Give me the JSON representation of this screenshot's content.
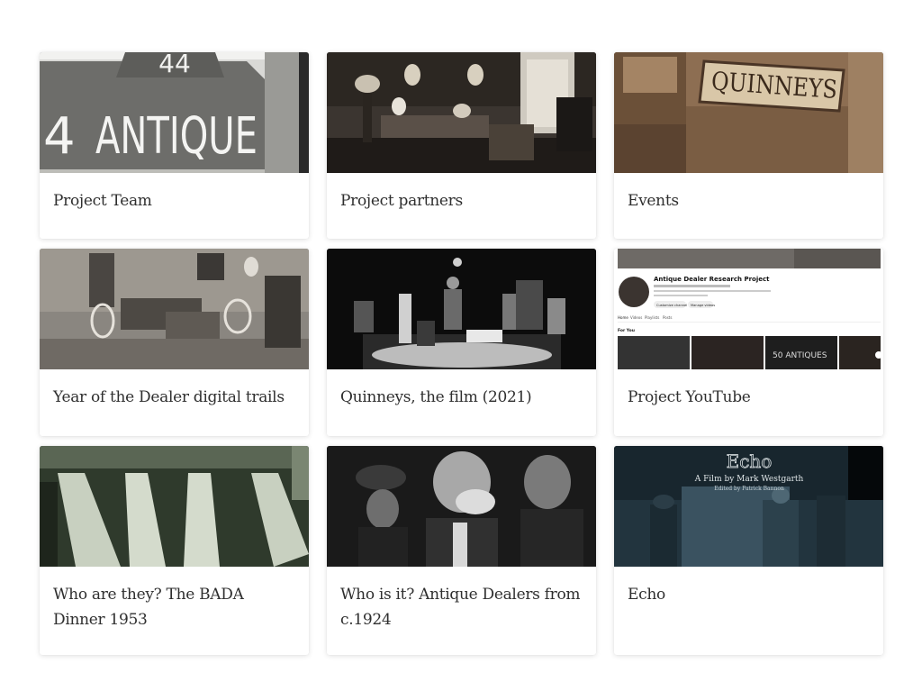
{
  "cards": [
    {
      "title": "Project Team",
      "image_text": [
        "44",
        "ANTIQUE",
        "4"
      ]
    },
    {
      "title": "Project partners"
    },
    {
      "title": "Events",
      "image_text": [
        "QUINNEYS"
      ]
    },
    {
      "title": "Year of the Dealer digital trails"
    },
    {
      "title": "Quinneys, the film (2021)"
    },
    {
      "title": "Project YouTube",
      "youtube": {
        "channel_name": "Antique Dealer Research Project",
        "buttons": [
          "Customize channel",
          "Manage videos"
        ],
        "tabs": [
          "Home",
          "Videos",
          "Playlists",
          "Posts"
        ],
        "section": "For You",
        "thumb_text": "50 ANTIQUES"
      }
    },
    {
      "title": "Who are they? The BADA Dinner 1953"
    },
    {
      "title": "Who is it? Antique Dealers from c.1924"
    },
    {
      "title": "Echo",
      "echo": {
        "title": "Echo",
        "line1": "A Film by Mark Westgarth",
        "line2": "Edited by Patrick Bannon"
      }
    }
  ],
  "colors": {
    "card_text": "#2f2f2f",
    "background": "#ffffff"
  }
}
